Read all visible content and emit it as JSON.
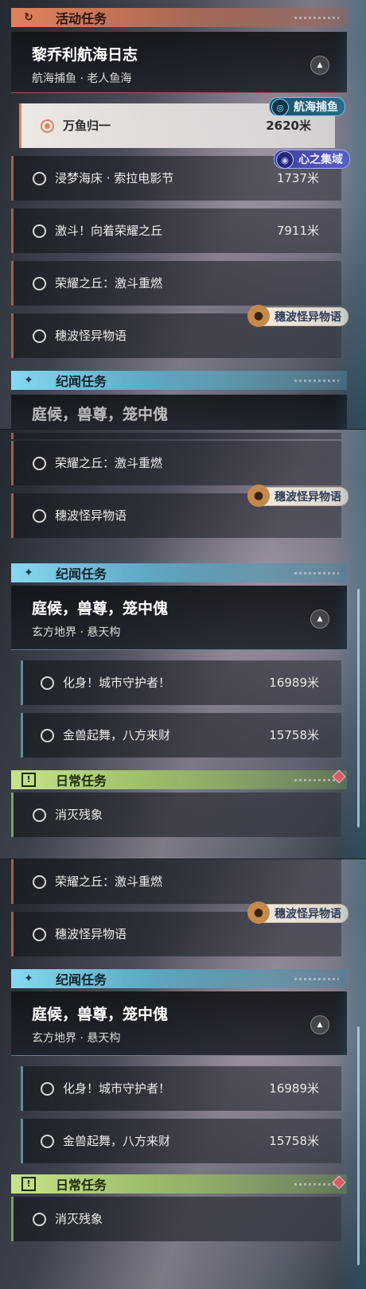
{
  "sections": {
    "activity": {
      "title": "活动任务",
      "icon": "refresh-quest-icon"
    },
    "story": {
      "title": "纪闻任务",
      "icon": "sparkle-quest-icon"
    },
    "daily": {
      "title": "日常任务",
      "icon": "exclamation-quest-icon",
      "icon_glyph": "!"
    }
  },
  "activity_quest": {
    "title": "黎乔利航海日志",
    "subtitle": "航海捕鱼 · 老人鱼海",
    "tasks": [
      {
        "name": "万鱼归一",
        "distance": "2620米",
        "active": true,
        "tag": "航海捕鱼"
      },
      {
        "name": "浸梦海床 · 索拉电影节",
        "distance": "1737米",
        "tag": "心之集域"
      },
      {
        "name": "激斗！向着荣耀之丘",
        "distance": "7911米"
      },
      {
        "name": "荣耀之丘：激斗重燃",
        "distance": ""
      },
      {
        "name": "穗波怪异物语",
        "distance": "",
        "tag": "穗波怪异物语"
      }
    ]
  },
  "story_quest": {
    "title": "庭候，兽尊，笼中傀",
    "subtitle": "玄方地界 · 悬天构",
    "partial_title": "庭候，兽尊，笼中傀",
    "tasks": [
      {
        "name": "化身！城市守护者！",
        "distance": "16989米"
      },
      {
        "name": "金兽起舞，八方来财",
        "distance": "15758米"
      }
    ]
  },
  "daily_quest": {
    "tasks": [
      {
        "name": "消灭残象"
      }
    ]
  },
  "colors": {
    "activity": "#e0825a",
    "story": "#86d8f0",
    "daily": "#c8e38a",
    "alert": "#e05a68"
  }
}
